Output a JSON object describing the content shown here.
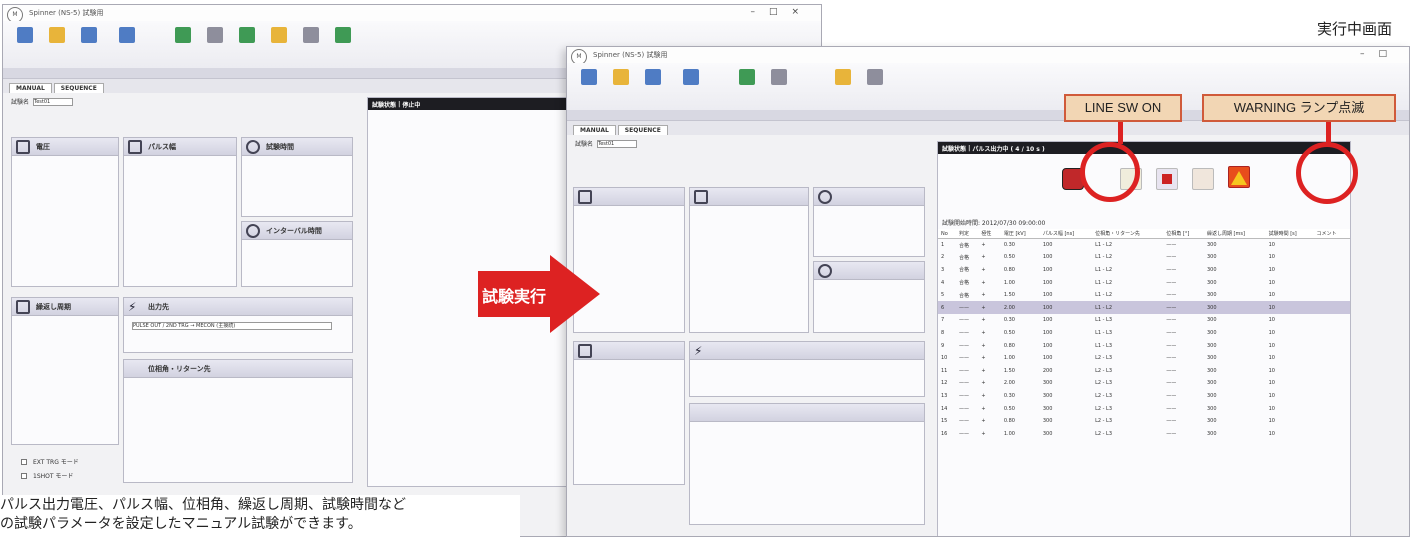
{
  "page": {
    "caption_top_right": "実行中画面",
    "arrow_label": "試験実行",
    "description_line1": "パルス出力電圧、パルス幅、位相角、繰返し周期、試験時間など",
    "description_line2": "の試験パラメータを設定したマニュアル試験ができます。",
    "callout_line_sw": "LINE SW ON",
    "callout_warning": "WARNING ランプ点滅",
    "accent_red": "#dd2222",
    "callout_bg": "#f2d6b4"
  },
  "left_window": {
    "title": "Spinner (NS-5) 試験用",
    "tab_manual": "MANUAL",
    "tab_sequence": "SEQUENCE",
    "test_name_label": "試験名",
    "test_name_value": "Test01",
    "voltage_panel": "電圧",
    "pulse_panel": "パルス幅",
    "test_time_panel": "試験時間",
    "interval_panel": "インターバル時間",
    "repeat_panel": "繰返し周期",
    "output_panel": "出力先",
    "phase_panel": "位相角・リターン先",
    "output_value": "PULSE OUT / 2ND TRG → MECON (主接続)",
    "side_title": "試験状態",
    "side_status": "停止中",
    "ext_trg": "EXT TRG モード",
    "one_shot": "1SHOT モード"
  },
  "right_window": {
    "title": "Spinner (NS-5) 試験用",
    "tab_manual": "MANUAL",
    "tab_sequence": "SEQUENCE",
    "test_name_label": "試験名",
    "test_name_value": "Test01",
    "status_title": "試験状態",
    "status_value": "パルス出力中 ( 4 / 10 s )",
    "test_start": "試験開始時間: 2012/07/30 09:00:00",
    "headers": [
      "No",
      "判定",
      "極性",
      "電圧 [kV]",
      "パルス幅 [ns]",
      "位相角・リターン先",
      "位相角 [°]",
      "繰返し周期 [ms]",
      "試験時間 [s]",
      "コメント"
    ],
    "rows": [
      [
        "1",
        "合格",
        "+",
        "0.30",
        "100",
        "L1 - L2",
        "——",
        "300",
        "10",
        ""
      ],
      [
        "2",
        "合格",
        "+",
        "0.50",
        "100",
        "L1 - L2",
        "——",
        "300",
        "10",
        ""
      ],
      [
        "3",
        "合格",
        "+",
        "0.80",
        "100",
        "L1 - L2",
        "——",
        "300",
        "10",
        ""
      ],
      [
        "4",
        "合格",
        "+",
        "1.00",
        "100",
        "L1 - L2",
        "——",
        "300",
        "10",
        ""
      ],
      [
        "5",
        "合格",
        "+",
        "1.50",
        "100",
        "L1 - L2",
        "——",
        "300",
        "10",
        ""
      ],
      [
        "6",
        "——",
        "+",
        "2.00",
        "100",
        "L1 - L2",
        "——",
        "300",
        "10",
        ""
      ],
      [
        "7",
        "——",
        "+",
        "0.30",
        "100",
        "L1 - L3",
        "——",
        "300",
        "10",
        ""
      ],
      [
        "8",
        "——",
        "+",
        "0.50",
        "100",
        "L1 - L3",
        "——",
        "300",
        "10",
        ""
      ],
      [
        "9",
        "——",
        "+",
        "0.80",
        "100",
        "L1 - L3",
        "——",
        "300",
        "10",
        ""
      ],
      [
        "10",
        "——",
        "+",
        "1.00",
        "100",
        "L2 - L3",
        "——",
        "300",
        "10",
        ""
      ],
      [
        "11",
        "——",
        "+",
        "1.50",
        "200",
        "L2 - L3",
        "——",
        "300",
        "10",
        ""
      ],
      [
        "12",
        "——",
        "+",
        "2.00",
        "300",
        "L2 - L3",
        "——",
        "300",
        "10",
        ""
      ],
      [
        "13",
        "——",
        "+",
        "0.30",
        "300",
        "L2 - L3",
        "——",
        "300",
        "10",
        ""
      ],
      [
        "14",
        "——",
        "+",
        "0.50",
        "300",
        "L2 - L3",
        "——",
        "300",
        "10",
        ""
      ],
      [
        "15",
        "——",
        "+",
        "0.80",
        "300",
        "L2 - L3",
        "——",
        "300",
        "10",
        ""
      ],
      [
        "16",
        "——",
        "+",
        "1.00",
        "300",
        "L2 - L3",
        "——",
        "300",
        "10",
        ""
      ]
    ]
  }
}
